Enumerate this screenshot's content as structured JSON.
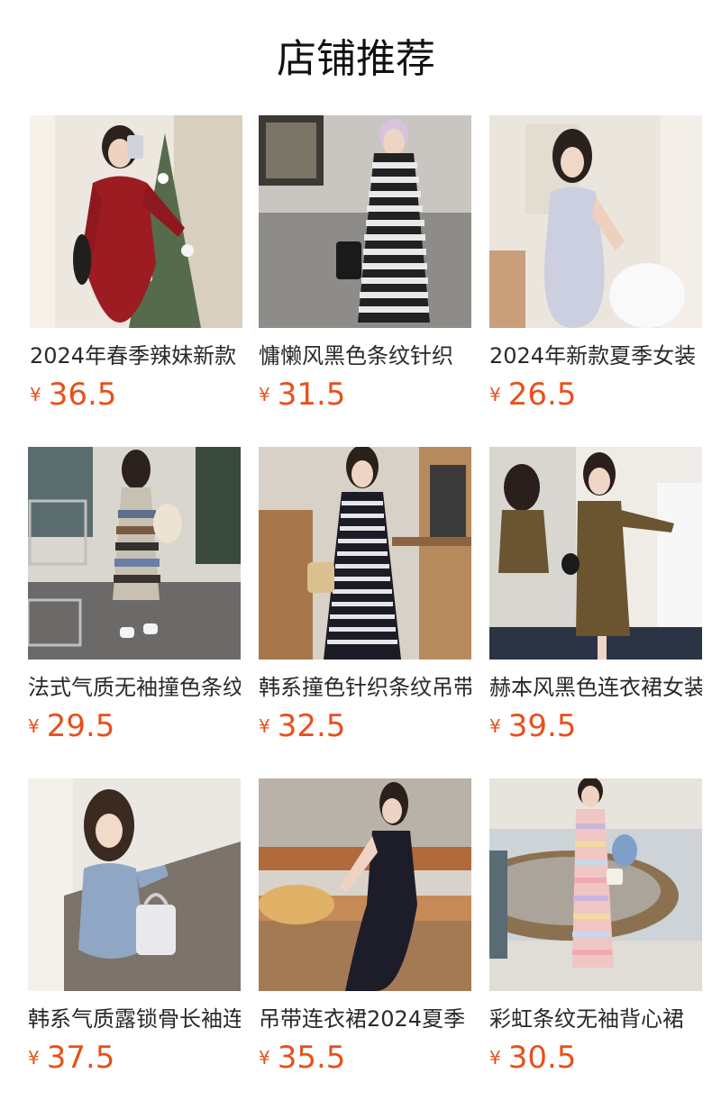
{
  "section": {
    "title": "店铺推荐"
  },
  "currency_symbol": "¥",
  "products": [
    {
      "name": "2024年春季辣妹新款",
      "price": "36.5"
    },
    {
      "name": "慵懒风黑色条纹针织",
      "price": "31.5"
    },
    {
      "name": "2024年新款夏季女装",
      "price": "26.5"
    },
    {
      "name": "法式气质无袖撞色条纹",
      "price": "29.5"
    },
    {
      "name": "韩系撞色针织条纹吊带",
      "price": "32.5"
    },
    {
      "name": "赫本风黑色连衣裙女装",
      "price": "39.5"
    },
    {
      "name": "韩系气质露锁骨长袖连",
      "price": "37.5"
    },
    {
      "name": "吊带连衣裙2024夏季",
      "price": "35.5"
    },
    {
      "name": "彩虹条纹无袖背心裙",
      "price": "30.5"
    }
  ],
  "colors": {
    "price": "#e8501c",
    "title": "#111111",
    "name": "#2a2a2a"
  },
  "icons": {
    "product_image": "dress-photo-icon"
  }
}
